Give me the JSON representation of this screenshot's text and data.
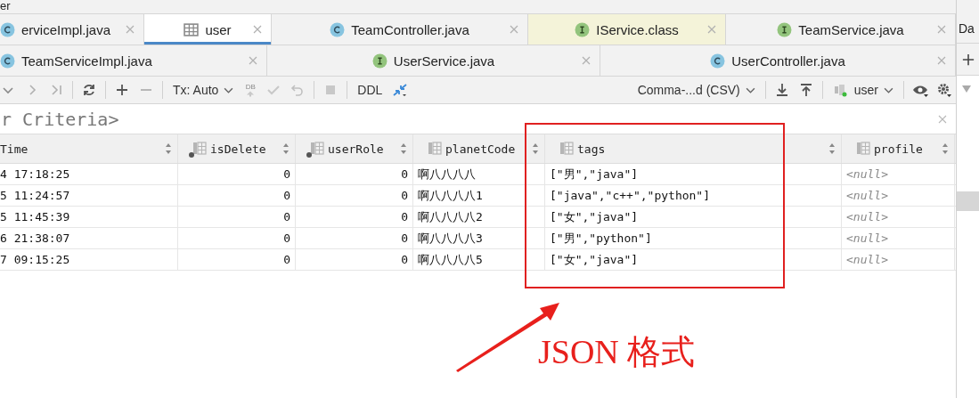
{
  "title": "er",
  "tab_rows": [
    [
      {
        "label": "erviceImpl.java",
        "kind": "class",
        "selected": false,
        "library": false
      },
      {
        "label": "user",
        "kind": "table",
        "selected": true,
        "library": false
      },
      {
        "label": "TeamController.java",
        "kind": "class",
        "selected": false,
        "library": false
      },
      {
        "label": "IService.class",
        "kind": "interface",
        "selected": false,
        "library": true
      },
      {
        "label": "TeamService.java",
        "kind": "interface",
        "selected": false,
        "library": false
      }
    ],
    [
      {
        "label": "TeamServiceImpl.java",
        "kind": "class",
        "selected": false,
        "library": false
      },
      {
        "label": "UserService.java",
        "kind": "interface",
        "selected": false,
        "library": false
      },
      {
        "label": "UserController.java",
        "kind": "class",
        "selected": false,
        "library": false
      }
    ]
  ],
  "side_panel": {
    "label": "Da"
  },
  "toolbar": {
    "tx_mode": "Tx: Auto",
    "db_mark": "DB",
    "ddl": "DDL",
    "export_format": "Comma-...d (CSV)",
    "datasource": "user"
  },
  "filter": {
    "text": "r Criteria>"
  },
  "table": {
    "columns": [
      {
        "name": "Time",
        "kind": "text",
        "key_marker": false,
        "icon": false
      },
      {
        "name": "isDelete",
        "kind": "number",
        "key_marker": true,
        "icon": true
      },
      {
        "name": "userRole",
        "kind": "number",
        "key_marker": true,
        "icon": true
      },
      {
        "name": "planetCode",
        "kind": "text",
        "key_marker": false,
        "icon": true
      },
      {
        "name": "tags",
        "kind": "text",
        "key_marker": false,
        "icon": true
      },
      {
        "name": "profile",
        "kind": "null",
        "key_marker": false,
        "icon": true
      }
    ],
    "rows": [
      [
        "4 17:18:25",
        "0",
        "0",
        "啊八八八八",
        "[\"男\",\"java\"]",
        "<null>"
      ],
      [
        "5 11:24:57",
        "0",
        "0",
        "啊八八八八1",
        "[\"java\",\"c++\",\"python\"]",
        "<null>"
      ],
      [
        "5 11:45:39",
        "0",
        "0",
        "啊八八八八2",
        "[\"女\",\"java\"]",
        "<null>"
      ],
      [
        "6 21:38:07",
        "0",
        "0",
        "啊八八八八3",
        "[\"男\",\"python\"]",
        "<null>"
      ],
      [
        "7 09:15:25",
        "0",
        "0",
        "啊八八八八5",
        "[\"女\",\"java\"]",
        "<null>"
      ]
    ]
  },
  "annotation": {
    "label": "JSON 格式"
  }
}
